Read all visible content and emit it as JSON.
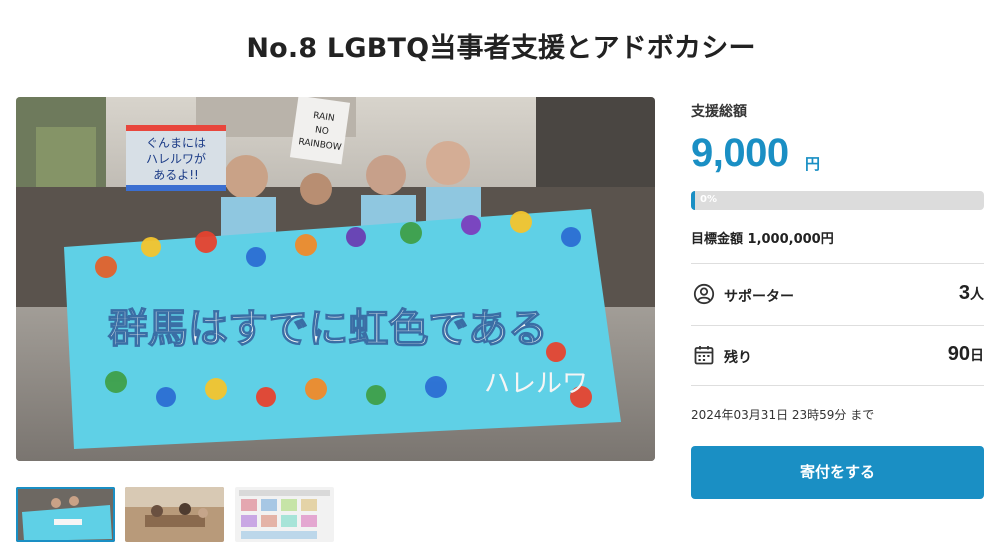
{
  "page": {
    "title": "No.8 LGBTQ当事者支援とアドボカシー"
  },
  "funding": {
    "label": "支援総額",
    "amount": "9,000",
    "unit": "円",
    "progress_text": "0%",
    "progress_fraction": 0.009,
    "goal_text": "目標金額 1,000,000円"
  },
  "stats": {
    "supporters": {
      "label": "サポーター",
      "value": "3",
      "unit": "人",
      "icon": "person-circle-icon"
    },
    "remaining": {
      "label": "残り",
      "value": "90",
      "unit": "日",
      "icon": "calendar-icon"
    }
  },
  "deadline": "2024年03月31日 23時59分 まで",
  "donate_label": "寄付をする",
  "main_image": {
    "sign_text": "ぐんまには ハレルワが あるよ!!",
    "banner_text_1": "群馬はすでに虹色である",
    "banner_text_2": "ハレルワ",
    "placard_text": "RAIN NO RAINBOW"
  },
  "colors": {
    "accent": "#1a8fc4",
    "banner": "#5fd0e6",
    "track": "#dcdcdc"
  }
}
